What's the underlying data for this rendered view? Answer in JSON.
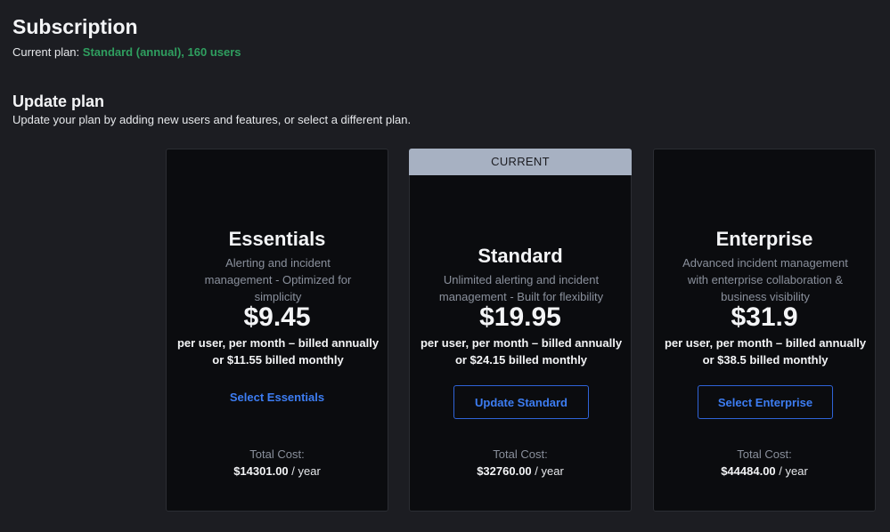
{
  "header": {
    "title": "Subscription",
    "current_plan_label": "Current plan:",
    "current_plan_value": "Standard (annual), 160 users"
  },
  "update": {
    "title": "Update plan",
    "description": "Update your plan by adding new users and features, or select a different plan."
  },
  "plans": [
    {
      "name": "Essentials",
      "description": "Alerting and incident management - Optimized for simplicity",
      "price": "$9.45",
      "billing": "per user, per month – billed annually or $11.55 billed monthly",
      "action_label": "Select Essentials",
      "total_label": "Total Cost:",
      "total_amount": "$14301.00",
      "total_suffix": " / year",
      "current": false
    },
    {
      "name": "Standard",
      "badge": "CURRENT",
      "description": "Unlimited alerting and incident management - Built for flexibility",
      "price": "$19.95",
      "billing": "per user, per month – billed annually or $24.15 billed monthly",
      "action_label": "Update Standard",
      "total_label": "Total Cost:",
      "total_amount": "$32760.00",
      "total_suffix": " / year",
      "current": true
    },
    {
      "name": "Enterprise",
      "description": "Advanced incident management with enterprise collaboration & business visibility",
      "price": "$31.9",
      "billing": "per user, per month – billed annually or $38.5 billed monthly",
      "action_label": "Select Enterprise",
      "total_label": "Total Cost:",
      "total_amount": "$44484.00",
      "total_suffix": " / year",
      "current": false
    }
  ],
  "colors": {
    "background": "#1c1d22",
    "card_background": "#0b0c0f",
    "accent_blue": "#3d7df2",
    "current_plan_green": "#2f9e5f",
    "badge_background": "#a7b1c2",
    "muted_text": "#8a909c"
  }
}
